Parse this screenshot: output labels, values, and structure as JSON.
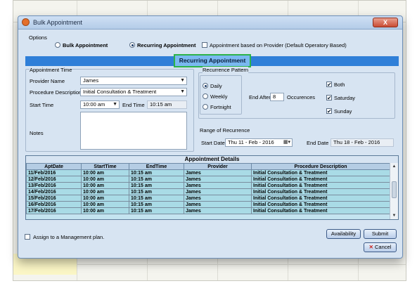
{
  "window": {
    "title": "Bulk Appointment",
    "close": "X"
  },
  "options": {
    "group_label": "Options",
    "bulk_label": "Bulk Appointment",
    "recurring_label": "Recurring Appointment",
    "provider_based_label": "Appointment based on Provider (Default Operatory Based)"
  },
  "section_title": "Recurring Appointment",
  "appointment_time": {
    "group_label": "Appointment Time",
    "provider_label": "Provider Name",
    "provider_value": "James",
    "procedure_label": "Procedure Description",
    "procedure_value": "Initial Consultation & Treatment",
    "start_label": "Start Time",
    "start_value": "10:00 am",
    "end_label": "End Time",
    "end_value": "10:15 am",
    "notes_label": "Notes",
    "notes_value": ""
  },
  "recurrence": {
    "group_label": "Recurrence Pattern",
    "daily": "Daily",
    "weekly": "Weekly",
    "fortnight": "Fortnight",
    "end_after_label": "End After",
    "end_after_value": "8",
    "occurences_label": "Occurences",
    "both": "Both",
    "saturday": "Saturday",
    "sunday": "Sunday",
    "check": "✔"
  },
  "range": {
    "group_label": "Range of Recurrence",
    "start_label": "Start Date",
    "start_value": "Thu 11 - Feb - 2016",
    "end_label": "End Date",
    "end_value": "Thu 18 - Feb - 2016"
  },
  "grid": {
    "caption": "Appointment Details",
    "columns": [
      "AptDate",
      "StartTime",
      "EndTime",
      "Provider",
      "Procedure Description"
    ],
    "rows": [
      [
        "11/Feb/2016",
        "10:00 am",
        "10:15 am",
        "James",
        "Initial Consultation & Treatment"
      ],
      [
        "12/Feb/2016",
        "10:00 am",
        "10:15 am",
        "James",
        "Initial Consultation & Treatment"
      ],
      [
        "13/Feb/2016",
        "10:00 am",
        "10:15 am",
        "James",
        "Initial Consultation & Treatment"
      ],
      [
        "14/Feb/2016",
        "10:00 am",
        "10:15 am",
        "James",
        "Initial Consultation & Treatment"
      ],
      [
        "15/Feb/2016",
        "10:00 am",
        "10:15 am",
        "James",
        "Initial Consultation & Treatment"
      ],
      [
        "16/Feb/2016",
        "10:00 am",
        "10:15 am",
        "James",
        "Initial Consultation & Treatment"
      ],
      [
        "17/Feb/2016",
        "10:00 am",
        "10:15 am",
        "James",
        "Initial Consultation & Treatment"
      ]
    ]
  },
  "footer": {
    "management_plan_label": "Assign to a Management plan.",
    "availability": "Availability",
    "submit": "Submit",
    "cancel": "Cancel"
  },
  "colors": {
    "accent_band": "#2f7fd8",
    "highlight_border": "#2db34a",
    "row_bg": "#a9dbe6"
  }
}
